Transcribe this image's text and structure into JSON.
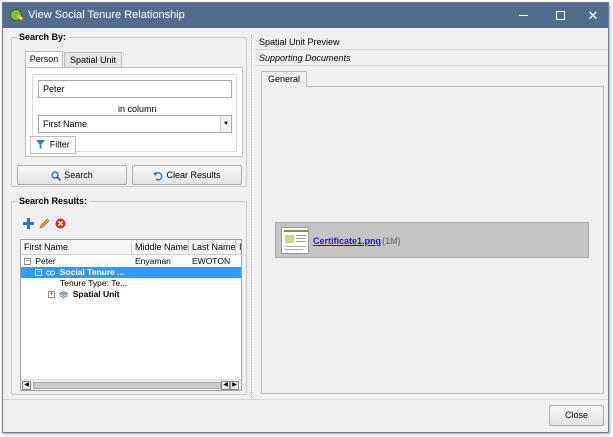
{
  "window": {
    "title": "View Social Tenure Relationship",
    "controls": {
      "minimize": "minimize",
      "maximize": "maximize",
      "close": "✕"
    }
  },
  "search_by": {
    "title": "Search By:",
    "tabs": [
      {
        "label": "Person",
        "active": true
      },
      {
        "label": "Spatial Unit",
        "active": false
      }
    ],
    "query_value": "Peter",
    "in_column_label": "in column",
    "column_selected": "First Name",
    "filter_label": "Filter"
  },
  "actions": {
    "search_label": "Search",
    "clear_label": "Clear Results"
  },
  "search_results": {
    "title": "Search Results:",
    "toolbar": [
      "add-icon",
      "edit-icon",
      "remove-icon"
    ],
    "columns": [
      "First Name",
      "Middle Name",
      "Last Name",
      "I"
    ],
    "rows": [
      {
        "level": 0,
        "expander": "−",
        "cells": [
          "Peter",
          "Enyaman",
          "EWOTON"
        ]
      },
      {
        "level": 1,
        "expander": "−",
        "label": "Social Tenure ...",
        "selected": true
      },
      {
        "level": 2,
        "label": "Tenure Type:  Te..."
      },
      {
        "level": 2,
        "expander": "+",
        "label": "Spatial Unit",
        "bold": true
      }
    ]
  },
  "right_panel": {
    "spatial_unit_preview": "Spatial Unit Preview",
    "supporting_documents": "Supporting Documents",
    "tabs": [
      "General"
    ],
    "document": {
      "filename": "Certificate1.png",
      "size": "(1M)"
    }
  },
  "footer": {
    "close_label": "Close"
  },
  "colors": {
    "titlebar": "#536c8c",
    "selection": "#3399ff",
    "link": "#1a1aee",
    "document_bg": "#c4c4c4"
  }
}
